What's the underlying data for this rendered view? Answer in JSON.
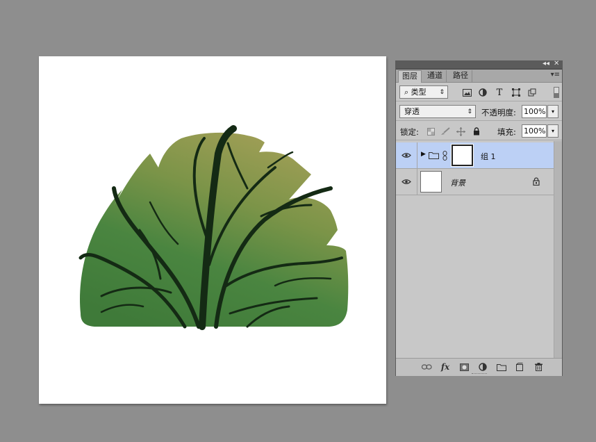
{
  "panel": {
    "collapse_icon": "◂◂",
    "close_icon": "✕",
    "tabs": [
      {
        "label": "图层",
        "active": true
      },
      {
        "label": "通道",
        "active": false
      },
      {
        "label": "路径",
        "active": false
      }
    ],
    "filter": {
      "search_glyph": "⌕",
      "label": "类型"
    },
    "blend_mode": "穿透",
    "opacity_label": "不透明度:",
    "opacity_value": "100%",
    "lock_label": "锁定:",
    "fill_label": "填充:",
    "fill_value": "100%",
    "layers": [
      {
        "name": "组 1",
        "visible": true,
        "selected": true,
        "type": "group"
      },
      {
        "name": "背景",
        "visible": true,
        "selected": false,
        "type": "background",
        "locked": true
      }
    ],
    "bottom_icons": [
      "link-icon",
      "fx-icon",
      "mask-icon",
      "adjustment-icon",
      "new-group-icon",
      "new-layer-icon",
      "trash-icon"
    ],
    "fx_text": "fx"
  },
  "colors": {
    "workspace": "#8e8e8e",
    "panel_bg": "#c8c8c8",
    "selected_layer": "#bcd0f5",
    "bush_light": "#a7a15a",
    "bush_dark": "#3d7a3a",
    "branches": "#142a14"
  }
}
